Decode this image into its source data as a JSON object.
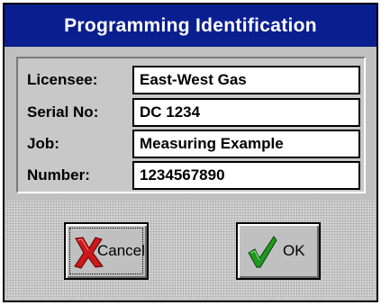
{
  "window": {
    "title": "Programming Identification"
  },
  "fields": [
    {
      "label": "Licensee:",
      "value": "East-West Gas"
    },
    {
      "label": "Serial No:",
      "value": "DC 1234"
    },
    {
      "label": "Job:",
      "value": "Measuring Example"
    },
    {
      "label": "Number:",
      "value": "1234567890"
    }
  ],
  "buttons": {
    "cancel": {
      "label": "Cancel",
      "icon": "red-x-icon"
    },
    "ok": {
      "label": "OK",
      "icon": "green-checkmark-icon"
    }
  },
  "colors": {
    "title_bar": "#0a1f8f",
    "title_text": "#ffffff",
    "dialog_bg": "#c0c0c0",
    "field_bg": "#ffffff",
    "cancel_icon": "#cc1a1a",
    "ok_icon": "#1f9a1f"
  }
}
